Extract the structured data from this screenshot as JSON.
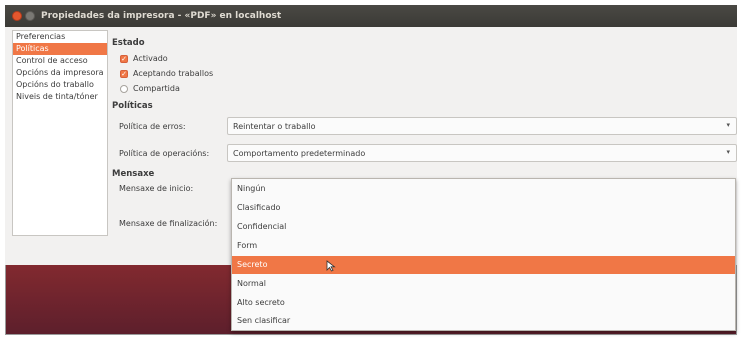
{
  "window": {
    "title": "Propiedades da impresora - «PDF» en localhost"
  },
  "sidebar": {
    "items": [
      {
        "label": "Preferencias",
        "selected": false
      },
      {
        "label": "Políticas",
        "selected": true
      },
      {
        "label": "Control de acceso",
        "selected": false
      },
      {
        "label": "Opcións da impresora",
        "selected": false
      },
      {
        "label": "Opcións do traballo",
        "selected": false
      },
      {
        "label": "Niveis de tinta/tóner",
        "selected": false
      }
    ]
  },
  "estado": {
    "heading": "Estado",
    "options": [
      {
        "label": "Activado",
        "checked": true
      },
      {
        "label": "Aceptando traballos",
        "checked": true
      },
      {
        "label": "Compartida",
        "checked": false
      }
    ]
  },
  "politicas": {
    "heading": "Políticas",
    "error_label": "Política de erros:",
    "error_value": "Reintentar o traballo",
    "operation_label": "Política de operacións:",
    "operation_value": "Comportamento predeterminado"
  },
  "mensaxe": {
    "heading": "Mensaxe",
    "start_label": "Mensaxe de inicio:",
    "end_label": "Mensaxe de finalización:"
  },
  "dropdown": {
    "options": [
      "Ningún",
      "Clasificado",
      "Confidencial",
      "Form",
      "Secreto",
      "Normal",
      "Alto secreto",
      "Sen clasificar"
    ],
    "selected_index": 4
  },
  "colors": {
    "accent": "#f07746",
    "titlebar": "#3b3a36",
    "window_bg": "#f2f1f0"
  }
}
